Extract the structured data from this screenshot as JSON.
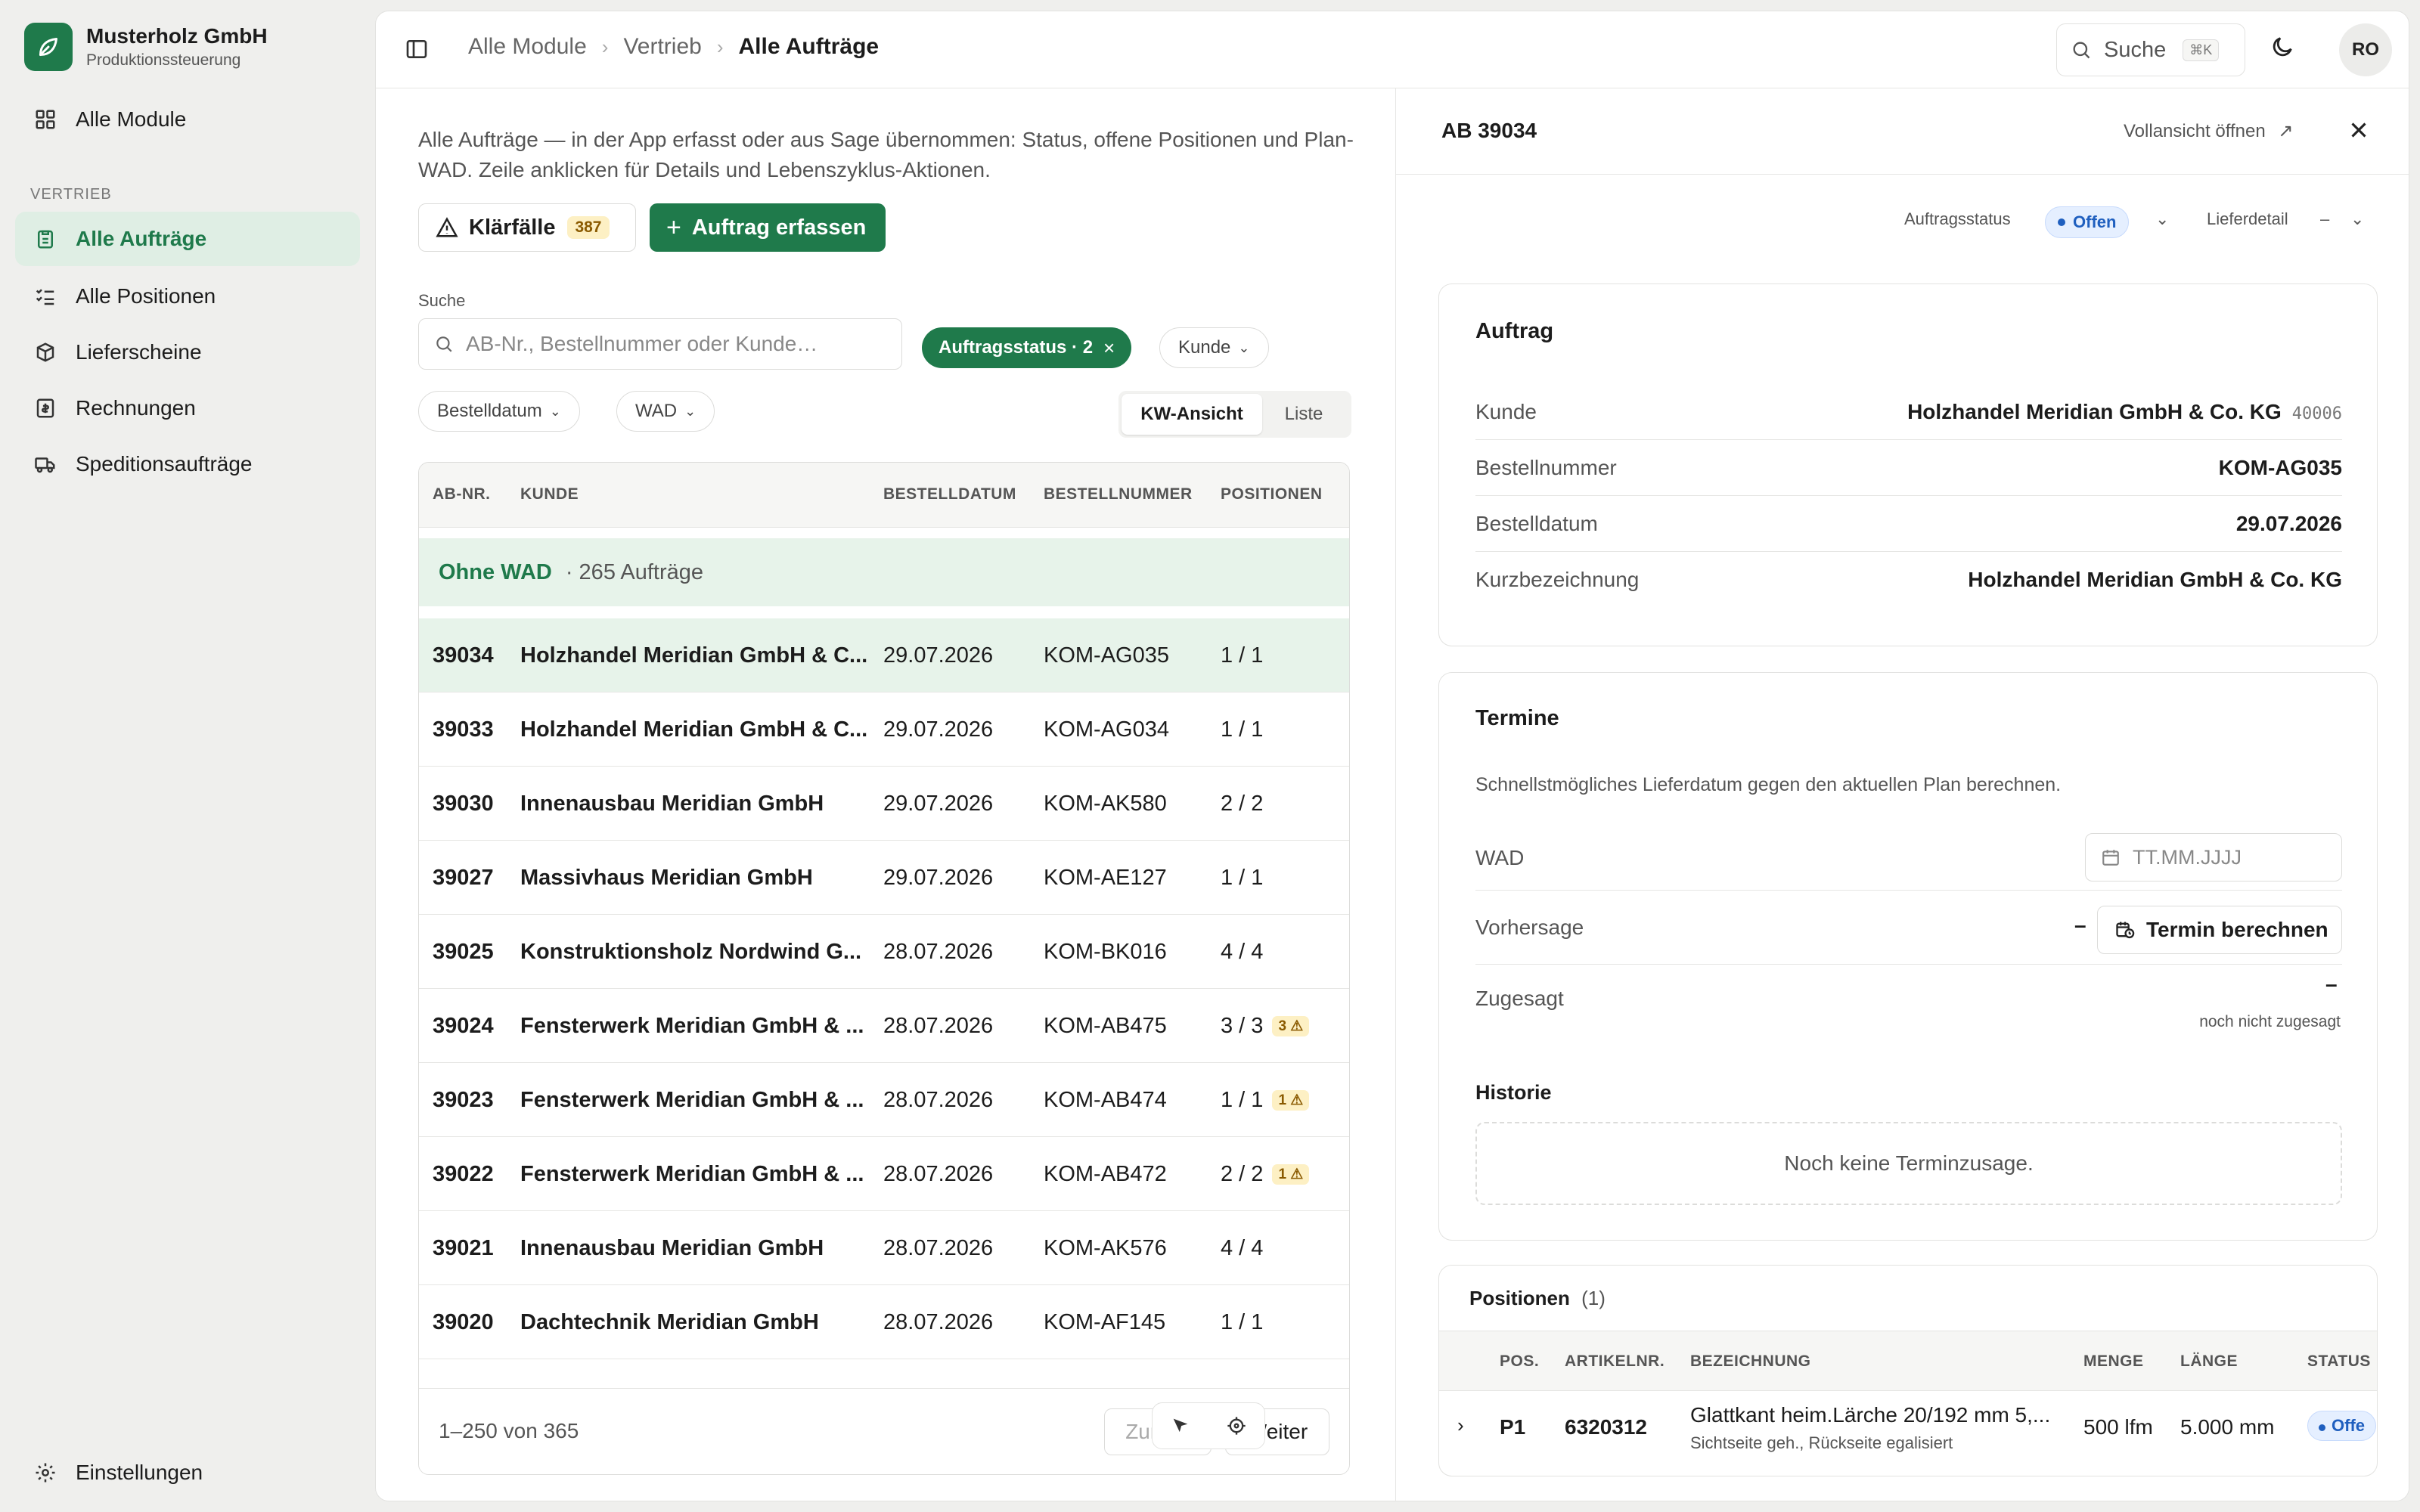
{
  "brand": {
    "name": "Musterholz GmbH",
    "subtitle": "Produktionssteuerung"
  },
  "sidebar": {
    "top_item": "Alle Module",
    "section": "VERTRIEB",
    "items": [
      {
        "label": "Alle Aufträge",
        "active": true
      },
      {
        "label": "Alle Positionen"
      },
      {
        "label": "Lieferscheine"
      },
      {
        "label": "Rechnungen"
      },
      {
        "label": "Speditionsaufträge"
      }
    ],
    "settings": "Einstellungen"
  },
  "topbar": {
    "breadcrumb": [
      "Alle Module",
      "Vertrieb",
      "Alle Aufträge"
    ],
    "search_label": "Suche",
    "search_shortcut": "⌘K",
    "avatar_initials": "RO"
  },
  "list": {
    "intro": "Alle Aufträge — in der App erfasst oder aus Sage übernommen: Status, offene Positionen und Plan-WAD. Zeile anklicken für Details und Lebenszyklus-Aktionen.",
    "klarfaelle_label": "Klärfälle",
    "klarfaelle_count": "387",
    "new_order_label": "Auftrag erfassen",
    "search_label": "Suche",
    "search_placeholder": "AB-Nr., Bestellnummer oder Kunde…",
    "filter_active": "Auftragsstatus · 2",
    "filter_kunde": "Kunde",
    "filter_bestelldatum": "Bestelldatum",
    "filter_wad": "WAD",
    "view_kw": "KW-Ansicht",
    "view_liste": "Liste",
    "columns": [
      "AB-NR.",
      "KUNDE",
      "BESTELLDATUM",
      "BESTELLNUMMER",
      "POSITIONEN"
    ],
    "group_title": "Ohne WAD",
    "group_count": "· 265 Aufträge",
    "rows": [
      {
        "ab": "39034",
        "kunde": "Holzhandel Meridian GmbH & C...",
        "datum": "29.07.2026",
        "bestellnr": "KOM-AG035",
        "pos": "1 / 1",
        "warn": ""
      },
      {
        "ab": "39033",
        "kunde": "Holzhandel Meridian GmbH & C...",
        "datum": "29.07.2026",
        "bestellnr": "KOM-AG034",
        "pos": "1 / 1",
        "warn": ""
      },
      {
        "ab": "39030",
        "kunde": "Innenausbau Meridian GmbH",
        "datum": "29.07.2026",
        "bestellnr": "KOM-AK580",
        "pos": "2 / 2",
        "warn": ""
      },
      {
        "ab": "39027",
        "kunde": "Massivhaus Meridian GmbH",
        "datum": "29.07.2026",
        "bestellnr": "KOM-AE127",
        "pos": "1 / 1",
        "warn": ""
      },
      {
        "ab": "39025",
        "kunde": "Konstruktionsholz Nordwind G...",
        "datum": "28.07.2026",
        "bestellnr": "KOM-BK016",
        "pos": "4 / 4",
        "warn": ""
      },
      {
        "ab": "39024",
        "kunde": "Fensterwerk Meridian GmbH & ...",
        "datum": "28.07.2026",
        "bestellnr": "KOM-AB475",
        "pos": "3 / 3",
        "warn": "3 ⚠"
      },
      {
        "ab": "39023",
        "kunde": "Fensterwerk Meridian GmbH & ...",
        "datum": "28.07.2026",
        "bestellnr": "KOM-AB474",
        "pos": "1 / 1",
        "warn": "1 ⚠"
      },
      {
        "ab": "39022",
        "kunde": "Fensterwerk Meridian GmbH & ...",
        "datum": "28.07.2026",
        "bestellnr": "KOM-AB472",
        "pos": "2 / 2",
        "warn": "1 ⚠"
      },
      {
        "ab": "39021",
        "kunde": "Innenausbau Meridian GmbH",
        "datum": "28.07.2026",
        "bestellnr": "KOM-AK576",
        "pos": "4 / 4",
        "warn": ""
      },
      {
        "ab": "39020",
        "kunde": "Dachtechnik Meridian GmbH",
        "datum": "28.07.2026",
        "bestellnr": "KOM-AF145",
        "pos": "1 / 1",
        "warn": ""
      }
    ],
    "range": "1–250 von 365",
    "prev": "Zurück",
    "next": "Weiter"
  },
  "detail": {
    "title": "AB 39034",
    "open_full": "Vollansicht öffnen",
    "status_label": "Auftragsstatus",
    "status_value": "Offen",
    "lieferdetail_label": "Lieferdetail",
    "lieferdetail_value": "–",
    "auftrag": {
      "title": "Auftrag",
      "kunde_label": "Kunde",
      "kunde_value": "Holzhandel Meridian GmbH & Co. KG",
      "kunde_nr": "40006",
      "bestellnr_label": "Bestellnummer",
      "bestellnr_value": "KOM-AG035",
      "bestelldatum_label": "Bestelldatum",
      "bestelldatum_value": "29.07.2026",
      "kurz_label": "Kurzbezeichnung",
      "kurz_value": "Holzhandel Meridian GmbH & Co. KG"
    },
    "termine": {
      "title": "Termine",
      "hint": "Schnellstmögliches Lieferdatum gegen den aktuellen Plan berechnen.",
      "wad_label": "WAD",
      "wad_placeholder": "TT.MM.JJJJ",
      "vorhersage_label": "Vorhersage",
      "vorhersage_value": "–",
      "calc_label": "Termin berechnen",
      "zugesagt_label": "Zugesagt",
      "zugesagt_value": "–",
      "zugesagt_note": "noch nicht zugesagt",
      "historie_label": "Historie",
      "historie_empty": "Noch keine Terminzusage."
    },
    "positionen": {
      "title": "Positionen",
      "count": "(1)",
      "columns": [
        "POS.",
        "ARTIKELNR.",
        "BEZEICHNUNG",
        "MENGE",
        "LÄNGE",
        "STATUS"
      ],
      "rows": [
        {
          "pos": "P1",
          "artikel": "6320312",
          "bez": "Glattkant heim.Lärche 20/192 mm 5,...",
          "bez_sub": "Sichtseite geh., Rückseite egalisiert",
          "menge": "500 lfm",
          "laenge": "5.000 mm",
          "status": "Offe"
        }
      ]
    }
  },
  "colors": {
    "accent": "#1f7a4b",
    "accent_light": "#e7f3ea",
    "warn_bg": "#fdf0c4",
    "status_blue": "#1f5fbf"
  }
}
